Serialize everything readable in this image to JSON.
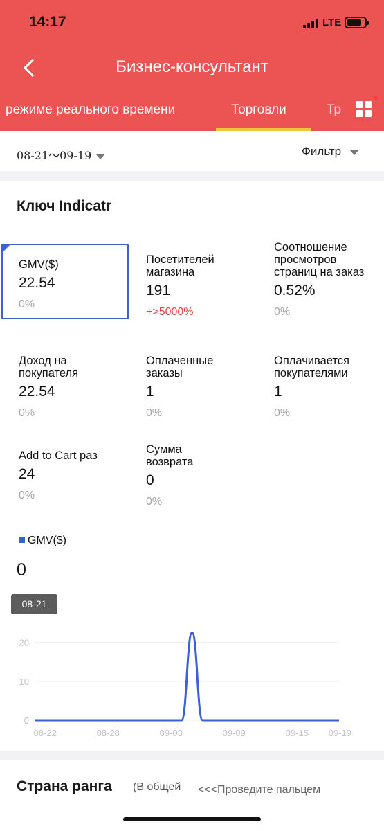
{
  "status_bar": {
    "time": "14:17",
    "network": "LTE"
  },
  "header": {
    "title": "Бизнес-консультант"
  },
  "tabs": [
    {
      "label": "режиме реального времени",
      "active": false
    },
    {
      "label": "Торговли",
      "active": true
    },
    {
      "label": "Тр",
      "active": false
    }
  ],
  "icons": {
    "back": "chevron-left-icon",
    "grid": "grid-menu-icon",
    "filter_caret": "caret-down-icon",
    "date_caret": "caret-down-icon"
  },
  "filter_bar": {
    "date_range": "08-21～09-19",
    "filter_label": "Фильтр"
  },
  "key_indicators": {
    "title": "Ключ Indicatr",
    "metrics": [
      {
        "label": "GMV($)",
        "value": "22.54",
        "change": "0%"
      },
      {
        "label": "Посетителей магазина",
        "value": "191",
        "change": "+>5000%"
      },
      {
        "label": "Соотношение просмотров страниц на заказ",
        "value": "0.52%",
        "change": "0%"
      },
      {
        "label": "Доход на покупателя",
        "value": "22.54",
        "change": "0%"
      },
      {
        "label": "Оплаченные заказы",
        "value": "1",
        "change": "0%"
      },
      {
        "label": "Оплачивается покупателями",
        "value": "1",
        "change": "0%"
      },
      {
        "label": "Add to Cart раз",
        "value": "24",
        "change": "0%"
      },
      {
        "label": "Сумма возврата",
        "value": "0",
        "change": "0%"
      }
    ]
  },
  "chart_legend": "GMV($)",
  "tooltip": {
    "value": "0",
    "date": "08-21"
  },
  "colors": {
    "header": "#ec5454",
    "accent": "#3c61d4",
    "tab_underline": "#f4c242",
    "negative_change": "#e24545"
  },
  "chart_data": {
    "type": "line",
    "series": [
      {
        "name": "GMV($)",
        "x": [
          "08-21",
          "08-22",
          "08-23",
          "08-24",
          "08-25",
          "08-26",
          "08-27",
          "08-28",
          "08-29",
          "08-30",
          "08-31",
          "09-01",
          "09-02",
          "09-03",
          "09-04",
          "09-05",
          "09-06",
          "09-07",
          "09-08",
          "09-09",
          "09-10",
          "09-11",
          "09-12",
          "09-13",
          "09-14",
          "09-15",
          "09-16",
          "09-17",
          "09-18",
          "09-19"
        ],
        "values": [
          0,
          0,
          0,
          0,
          0,
          0,
          0,
          0,
          0,
          0,
          0,
          0,
          0,
          0,
          0,
          22.54,
          0,
          0,
          0,
          0,
          0,
          0,
          0,
          0,
          0,
          0,
          0,
          0,
          0,
          0
        ]
      }
    ],
    "x_tick_labels": [
      "08-22",
      "08-28",
      "09-03",
      "09-09",
      "09-15",
      "09-19"
    ],
    "y_ticks": [
      0,
      10,
      20
    ],
    "ylim": [
      0,
      26
    ],
    "grid": true
  },
  "country_rank": {
    "title": "Страна ранга",
    "subtitle": "(В общей",
    "hint": "<<<Проведите пальцем"
  }
}
